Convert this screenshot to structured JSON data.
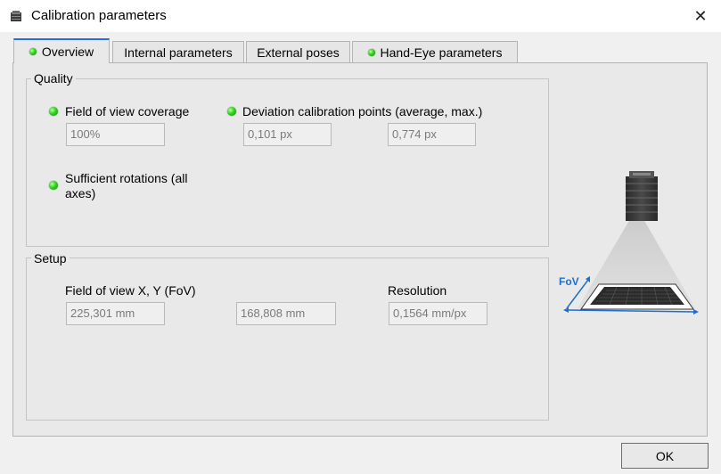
{
  "window": {
    "title": "Calibration parameters",
    "close_glyph": "✕"
  },
  "tabs": [
    {
      "label": "Overview",
      "has_led": true,
      "active": true
    },
    {
      "label": "Internal parameters",
      "has_led": false,
      "active": false
    },
    {
      "label": "External poses",
      "has_led": false,
      "active": false
    },
    {
      "label": "Hand-Eye parameters",
      "has_led": true,
      "active": false
    }
  ],
  "quality": {
    "legend": "Quality",
    "fov_coverage": {
      "label": "Field of view coverage",
      "value": "100%"
    },
    "deviation": {
      "label": "Deviation calibration points (average, max.)",
      "average": "0,101 px",
      "max": "0,774 px"
    },
    "rotations": {
      "label": "Sufficient rotations (all axes)"
    }
  },
  "setup": {
    "legend": "Setup",
    "fov": {
      "label": "Field of view X, Y (FoV)",
      "x": "225,301 mm",
      "y": "168,808 mm"
    },
    "resolution": {
      "label": "Resolution",
      "value": "0,1564 mm/px"
    }
  },
  "illustration": {
    "fov_label": "FoV"
  },
  "buttons": {
    "ok": "OK"
  },
  "colors": {
    "led_green": "#2fd31c",
    "active_tab_accent": "#2b6fd6",
    "fov_arrow": "#1e6fd0"
  },
  "icons": {
    "app": "camera-icon",
    "close": "close-icon",
    "status": "status-led-icon"
  }
}
